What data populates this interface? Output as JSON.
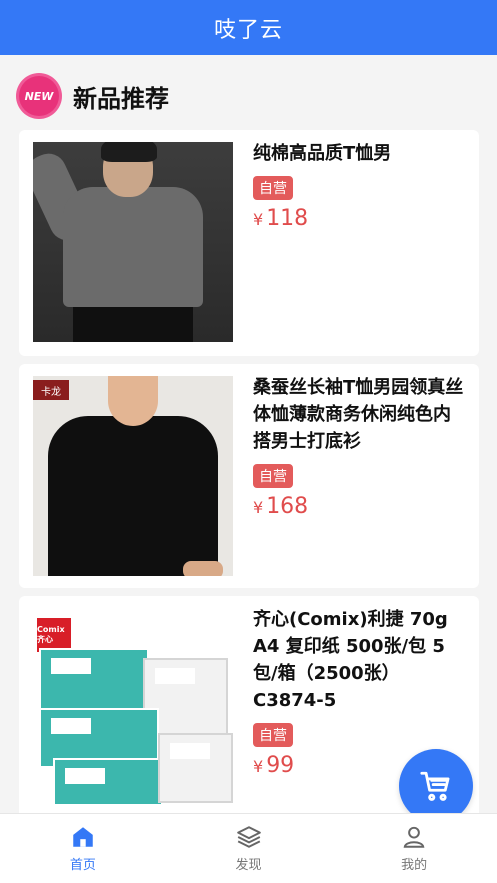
{
  "header": {
    "title": "吱了云"
  },
  "section": {
    "badge": "NEW",
    "title": "新品推荐"
  },
  "products": [
    {
      "name": "纯棉高品质T恤男",
      "tag": "自营",
      "currency": "¥",
      "price": "118"
    },
    {
      "name": "桑蚕丝长袖T恤男园领真丝体恤薄款商务休闲纯色内搭男士打底衫",
      "tag": "自营",
      "currency": "¥",
      "price": "168",
      "brand_mark": "卡龙"
    },
    {
      "name": "齐心(Comix)利捷 70g A4 复印纸 500张/包 5包/箱（2500张） C3874-5",
      "tag": "自营",
      "currency": "¥",
      "price": "99",
      "brand_mark": "Comix 齐心"
    }
  ],
  "cart_button": {
    "icon": "cart-icon"
  },
  "tabbar": {
    "items": [
      {
        "label": "首页",
        "icon": "home-icon",
        "active": true
      },
      {
        "label": "发现",
        "icon": "layers-icon",
        "active": false
      },
      {
        "label": "我的",
        "icon": "user-icon",
        "active": false
      }
    ]
  },
  "colors": {
    "primary": "#3478f6",
    "price": "#e04c4c",
    "tag_bg": "#e35b5b",
    "new_badge": "#e8327a"
  }
}
